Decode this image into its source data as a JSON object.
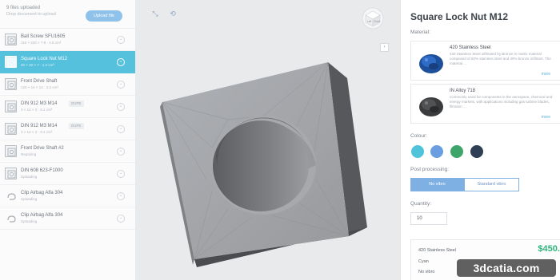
{
  "sidebar": {
    "files_uploaded": "9 files uploaded",
    "upload_status": "Drop document to upload",
    "upload_button": "Upload file",
    "items": [
      {
        "name": "Ball Screw SFU1605",
        "meta": "110 × 220 × 7.8 · 4.5 cm³",
        "tag": "",
        "selected": false,
        "thumb": "part"
      },
      {
        "name": "Square Lock Nut M12",
        "meta": "20 × 20 × 7 · 1.2 cm³",
        "tag": "",
        "selected": true,
        "thumb": "part"
      },
      {
        "name": "Front Drive Shaft",
        "meta": "120 × 14 × 14 · 4.2 cm³",
        "tag": "",
        "selected": false,
        "thumb": "part"
      },
      {
        "name": "DIN 912 M3 M14",
        "meta": "3 × 14 × 3 · 0.1 cm³",
        "tag": "DUPE",
        "selected": false,
        "thumb": "part"
      },
      {
        "name": "DIN 912 M3 M14",
        "meta": "3 × 14 × 3 · 0.1 cm³",
        "tag": "DUPE",
        "selected": false,
        "thumb": "part"
      },
      {
        "name": "Front Drive Shaft #2",
        "meta": "Repairing",
        "tag": "",
        "selected": false,
        "thumb": "part"
      },
      {
        "name": "DIN 608 623-F1000",
        "meta": "Uploading",
        "tag": "",
        "selected": false,
        "thumb": "part"
      },
      {
        "name": "Clip Airbag Alfa 304",
        "meta": "Uploading",
        "tag": "",
        "selected": false,
        "thumb": "clip"
      },
      {
        "name": "Clip Airbag Alfa 304",
        "meta": "Uploading",
        "tag": "",
        "selected": false,
        "thumb": "clip"
      }
    ]
  },
  "viewport": {
    "tools": [
      "fit-view-icon",
      "rotate-view-icon"
    ],
    "orientation_labels": {
      "left": "Left",
      "front": "Front"
    },
    "collapse": "›"
  },
  "panel": {
    "title": "Square Lock Nut M12",
    "material_label": "Material:",
    "materials": [
      {
        "name": "420 Stainless Steel",
        "desc": "420 Stainless Steel infiltrated by Bronze is matrix material composed of 60% stainless steel and 40% bronze infiltrant. The material ...",
        "more": "more",
        "image": "blue-powder"
      },
      {
        "name": "IN Alloy 718",
        "desc": "Commonly used for components in the aerospace, chemical and energy markets, with applications including gas turbine blades, filtration ...",
        "more": "more",
        "image": "dark-powder"
      }
    ],
    "colour_label": "Colour:",
    "colours": [
      "#4fc3d9",
      "#6a9ee0",
      "#3da56a",
      "#2d3e55"
    ],
    "post_processing_label": "Post processing:",
    "post_processing_options": [
      "No vibro",
      "Standard vibro"
    ],
    "post_processing_selected": "No vibro",
    "quantity_label": "Quantity:",
    "quantity": "10",
    "summary": {
      "material": "420 Stainless Steel",
      "price": "$450.7",
      "colour": "Cyan",
      "post_processing": "No vibro"
    }
  },
  "watermark": "3dcatia.com"
}
